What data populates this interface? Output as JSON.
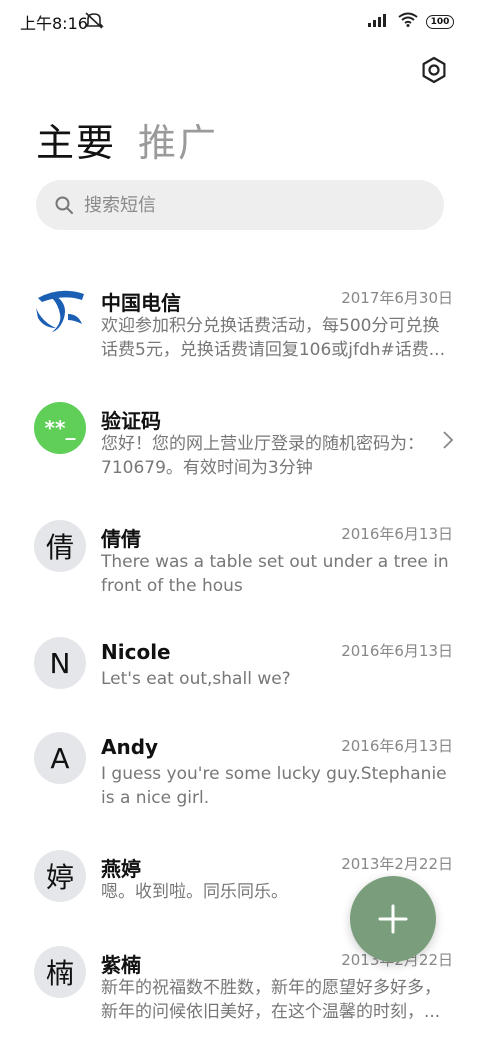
{
  "status": {
    "time": "上午8:16",
    "battery": "100"
  },
  "tabs": [
    {
      "label": "主要",
      "active": true
    },
    {
      "label": "推广",
      "active": false
    }
  ],
  "search": {
    "placeholder": "搜索短信"
  },
  "messages": [
    {
      "avatar": "",
      "avatar_type": "telecom",
      "name": "中国电信",
      "date": "2017年6月30日",
      "preview": "欢迎参加积分兑换话费活动，每500分可兑换话费5元，兑换话费请回复106或jfdh#话费..."
    },
    {
      "avatar": "**_",
      "avatar_type": "green",
      "name": "验证码",
      "date": "",
      "preview": "您好！您的网上营业厅登录的随机密码为：710679。有效时间为3分钟"
    },
    {
      "avatar": "倩",
      "avatar_type": "letter",
      "name": "倩倩",
      "date": "2016年6月13日",
      "preview": "There was a table set out under a tree in front of the hous"
    },
    {
      "avatar": "N",
      "avatar_type": "letter",
      "name": "Nicole",
      "date": "2016年6月13日",
      "preview": "Let's eat out,shall we?"
    },
    {
      "avatar": "A",
      "avatar_type": "letter",
      "name": "Andy",
      "date": "2016年6月13日",
      "preview": "I guess you're some lucky guy.Stephanie is a nice girl."
    },
    {
      "avatar": "婷",
      "avatar_type": "letter",
      "name": "燕婷",
      "date": "2013年2月22日",
      "preview": "嗯。收到啦。同乐同乐。"
    },
    {
      "avatar": "楠",
      "avatar_type": "letter",
      "name": "紫楠",
      "date": "2013年2月22日",
      "preview": "新年的祝福数不胜数，新年的愿望好多好多，新年的问候依旧美好，在这个温馨的时刻，..."
    }
  ],
  "colors": {
    "fab": "#7a9e7c",
    "verify_avatar": "#5fcf57",
    "telecom_blue": "#1b5fb5"
  },
  "icons": {
    "settings": "settings-gear-icon",
    "search": "search-icon",
    "fab": "plus-icon",
    "chevron": "chevron-right-icon"
  }
}
